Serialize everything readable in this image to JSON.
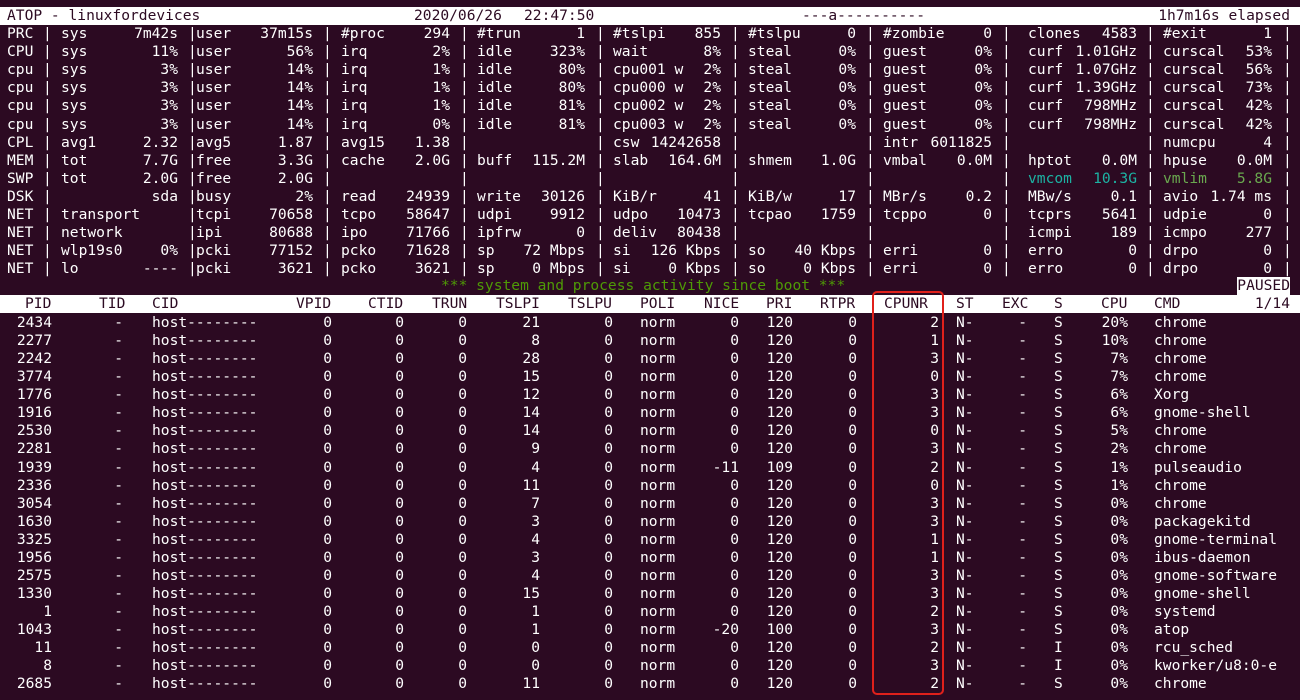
{
  "header": {
    "title": "ATOP - linuxfordevices",
    "date": "2020/06/26",
    "time": "22:47:50",
    "flags": "---a----------",
    "elapsed": "1h7m16s elapsed"
  },
  "system_rows": [
    [
      "PRC",
      "sys",
      "7m42s",
      "user",
      "37m15s",
      "#proc",
      "294",
      "#trun",
      "1",
      "#tslpi",
      "855",
      "#tslpu",
      "0",
      "#zombie",
      "0",
      "clones",
      "4583",
      "#exit",
      "1"
    ],
    [
      "CPU",
      "sys",
      "11%",
      "user",
      "56%",
      "irq",
      "2%",
      "idle",
      "323%",
      "wait",
      "8%",
      "steal",
      "0%",
      "guest",
      "0%",
      "curf",
      "1.01GHz",
      "curscal",
      "53%"
    ],
    [
      "cpu",
      "sys",
      "3%",
      "user",
      "14%",
      "irq",
      "1%",
      "idle",
      "80%",
      "cpu001 w",
      "2%",
      "steal",
      "0%",
      "guest",
      "0%",
      "curf",
      "1.07GHz",
      "curscal",
      "56%"
    ],
    [
      "cpu",
      "sys",
      "3%",
      "user",
      "14%",
      "irq",
      "1%",
      "idle",
      "80%",
      "cpu000 w",
      "2%",
      "steal",
      "0%",
      "guest",
      "0%",
      "curf",
      "1.39GHz",
      "curscal",
      "73%"
    ],
    [
      "cpu",
      "sys",
      "3%",
      "user",
      "14%",
      "irq",
      "1%",
      "idle",
      "81%",
      "cpu002 w",
      "2%",
      "steal",
      "0%",
      "guest",
      "0%",
      "curf",
      "798MHz",
      "curscal",
      "42%"
    ],
    [
      "cpu",
      "sys",
      "3%",
      "user",
      "14%",
      "irq",
      "0%",
      "idle",
      "81%",
      "cpu003 w",
      "2%",
      "steal",
      "0%",
      "guest",
      "0%",
      "curf",
      "798MHz",
      "curscal",
      "42%"
    ],
    [
      "CPL",
      "avg1",
      "2.32",
      "avg5",
      "1.87",
      "avg15",
      "1.38",
      "",
      "",
      "csw",
      "14242658",
      "",
      "",
      "intr",
      "6011825",
      "",
      "",
      "numcpu",
      "4"
    ],
    [
      "MEM",
      "tot",
      "7.7G",
      "free",
      "3.3G",
      "cache",
      "2.0G",
      "buff",
      "115.2M",
      "slab",
      "164.6M",
      "shmem",
      "1.0G",
      "vmbal",
      "0.0M",
      "hptot",
      "0.0M",
      "hpuse",
      "0.0M"
    ],
    [
      "SWP",
      "tot",
      "2.0G",
      "free",
      "2.0G",
      "",
      "",
      "",
      "",
      "",
      "",
      "",
      "",
      "",
      "",
      "vmcom",
      "10.3G",
      "vmlim",
      "5.8G"
    ],
    [
      "DSK",
      "",
      "sda",
      "busy",
      "2%",
      "read",
      "24939",
      "write",
      "30126",
      "KiB/r",
      "41",
      "KiB/w",
      "17",
      "MBr/s",
      "0.2",
      "MBw/s",
      "0.1",
      "avio",
      "1.74 ms"
    ],
    [
      "NET",
      "transport",
      "",
      "tcpi",
      "70658",
      "tcpo",
      "58647",
      "udpi",
      "9912",
      "udpo",
      "10473",
      "tcpao",
      "1759",
      "tcppo",
      "0",
      "tcprs",
      "5641",
      "udpie",
      "0"
    ],
    [
      "NET",
      "network",
      "",
      "ipi",
      "80688",
      "ipo",
      "71766",
      "ipfrw",
      "0",
      "deliv",
      "80438",
      "",
      "",
      "",
      "",
      "icmpi",
      "189",
      "icmpo",
      "277"
    ],
    [
      "NET",
      "wlp19s0",
      "0%",
      "pcki",
      "77152",
      "pcko",
      "71628",
      "sp",
      "72 Mbps",
      "si",
      "126 Kbps",
      "so",
      "40 Kbps",
      "erri",
      "0",
      "erro",
      "0",
      "drpo",
      "0"
    ],
    [
      "NET",
      "lo",
      "----",
      "pcki",
      "3621",
      "pcko",
      "3621",
      "sp",
      "0 Mbps",
      "si",
      "0 Kbps",
      "so",
      "0 Kbps",
      "erri",
      "0",
      "erro",
      "0",
      "drpo",
      "0"
    ]
  ],
  "boot_banner": "*** system and process activity since boot ***",
  "paused_label": "PAUSED",
  "page_indicator": "1/14",
  "process_columns": [
    "PID",
    "TID",
    "CID",
    "VPID",
    "CTID",
    "TRUN",
    "TSLPI",
    "TSLPU",
    "POLI",
    "NICE",
    "PRI",
    "RTPR",
    "CPUNR",
    "ST",
    "EXC",
    "S",
    "CPU",
    "CMD"
  ],
  "processes": [
    [
      "2434",
      "-",
      "host--------",
      "0",
      "0",
      "0",
      "21",
      "0",
      "norm",
      "0",
      "120",
      "0",
      "2",
      "N-",
      "-",
      "S",
      "20%",
      "chrome"
    ],
    [
      "2277",
      "-",
      "host--------",
      "0",
      "0",
      "0",
      "8",
      "0",
      "norm",
      "0",
      "120",
      "0",
      "1",
      "N-",
      "-",
      "S",
      "10%",
      "chrome"
    ],
    [
      "2242",
      "-",
      "host--------",
      "0",
      "0",
      "0",
      "28",
      "0",
      "norm",
      "0",
      "120",
      "0",
      "3",
      "N-",
      "-",
      "S",
      "7%",
      "chrome"
    ],
    [
      "3774",
      "-",
      "host--------",
      "0",
      "0",
      "0",
      "15",
      "0",
      "norm",
      "0",
      "120",
      "0",
      "0",
      "N-",
      "-",
      "S",
      "7%",
      "chrome"
    ],
    [
      "1776",
      "-",
      "host--------",
      "0",
      "0",
      "0",
      "12",
      "0",
      "norm",
      "0",
      "120",
      "0",
      "3",
      "N-",
      "-",
      "S",
      "6%",
      "Xorg"
    ],
    [
      "1916",
      "-",
      "host--------",
      "0",
      "0",
      "0",
      "14",
      "0",
      "norm",
      "0",
      "120",
      "0",
      "3",
      "N-",
      "-",
      "S",
      "6%",
      "gnome-shell"
    ],
    [
      "2530",
      "-",
      "host--------",
      "0",
      "0",
      "0",
      "14",
      "0",
      "norm",
      "0",
      "120",
      "0",
      "0",
      "N-",
      "-",
      "S",
      "5%",
      "chrome"
    ],
    [
      "2281",
      "-",
      "host--------",
      "0",
      "0",
      "0",
      "9",
      "0",
      "norm",
      "0",
      "120",
      "0",
      "3",
      "N-",
      "-",
      "S",
      "2%",
      "chrome"
    ],
    [
      "1939",
      "-",
      "host--------",
      "0",
      "0",
      "0",
      "4",
      "0",
      "norm",
      "-11",
      "109",
      "0",
      "2",
      "N-",
      "-",
      "S",
      "1%",
      "pulseaudio"
    ],
    [
      "2336",
      "-",
      "host--------",
      "0",
      "0",
      "0",
      "11",
      "0",
      "norm",
      "0",
      "120",
      "0",
      "0",
      "N-",
      "-",
      "S",
      "1%",
      "chrome"
    ],
    [
      "3054",
      "-",
      "host--------",
      "0",
      "0",
      "0",
      "7",
      "0",
      "norm",
      "0",
      "120",
      "0",
      "3",
      "N-",
      "-",
      "S",
      "0%",
      "chrome"
    ],
    [
      "1630",
      "-",
      "host--------",
      "0",
      "0",
      "0",
      "3",
      "0",
      "norm",
      "0",
      "120",
      "0",
      "3",
      "N-",
      "-",
      "S",
      "0%",
      "packagekitd"
    ],
    [
      "3325",
      "-",
      "host--------",
      "0",
      "0",
      "0",
      "4",
      "0",
      "norm",
      "0",
      "120",
      "0",
      "1",
      "N-",
      "-",
      "S",
      "0%",
      "gnome-terminal"
    ],
    [
      "1956",
      "-",
      "host--------",
      "0",
      "0",
      "0",
      "3",
      "0",
      "norm",
      "0",
      "120",
      "0",
      "1",
      "N-",
      "-",
      "S",
      "0%",
      "ibus-daemon"
    ],
    [
      "2575",
      "-",
      "host--------",
      "0",
      "0",
      "0",
      "4",
      "0",
      "norm",
      "0",
      "120",
      "0",
      "3",
      "N-",
      "-",
      "S",
      "0%",
      "gnome-software"
    ],
    [
      "1330",
      "-",
      "host--------",
      "0",
      "0",
      "0",
      "15",
      "0",
      "norm",
      "0",
      "120",
      "0",
      "3",
      "N-",
      "-",
      "S",
      "0%",
      "gnome-shell"
    ],
    [
      "1",
      "-",
      "host--------",
      "0",
      "0",
      "0",
      "1",
      "0",
      "norm",
      "0",
      "120",
      "0",
      "2",
      "N-",
      "-",
      "S",
      "0%",
      "systemd"
    ],
    [
      "1043",
      "-",
      "host--------",
      "0",
      "0",
      "0",
      "1",
      "0",
      "norm",
      "-20",
      "100",
      "0",
      "3",
      "N-",
      "-",
      "S",
      "0%",
      "atop"
    ],
    [
      "11",
      "-",
      "host--------",
      "0",
      "0",
      "0",
      "0",
      "0",
      "norm",
      "0",
      "120",
      "0",
      "2",
      "N-",
      "-",
      "I",
      "0%",
      "rcu_sched"
    ],
    [
      "8",
      "-",
      "host--------",
      "0",
      "0",
      "0",
      "0",
      "0",
      "norm",
      "0",
      "120",
      "0",
      "3",
      "N-",
      "-",
      "I",
      "0%",
      "kworker/u8:0-e"
    ],
    [
      "2685",
      "-",
      "host--------",
      "0",
      "0",
      "0",
      "11",
      "0",
      "norm",
      "0",
      "120",
      "0",
      "2",
      "N-",
      "-",
      "S",
      "0%",
      "chrome"
    ]
  ],
  "highlighted_column": "CPUNR",
  "colors": {
    "background": "#2c0a22",
    "text": "#ffffff",
    "teal": "#1cb3a3",
    "green": "#6aa84f",
    "banner": "#4e9a06",
    "highlight": "#e0201b"
  }
}
